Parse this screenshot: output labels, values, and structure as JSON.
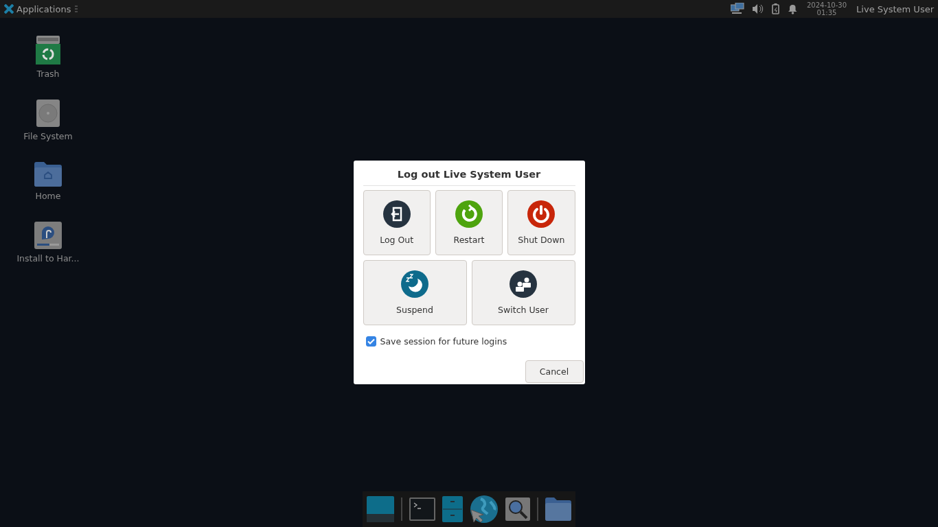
{
  "panel": {
    "menu_label": "Applications",
    "clock": {
      "date": "2024-10-30",
      "time": "01:35"
    },
    "user": "Live System User"
  },
  "desktop_icons": [
    {
      "label": "Trash",
      "kind": "trash"
    },
    {
      "label": "File System",
      "kind": "drive"
    },
    {
      "label": "Home",
      "kind": "home"
    },
    {
      "label": "Install to Har...",
      "kind": "installer"
    }
  ],
  "dialog": {
    "title": "Log out Live System User",
    "actions": [
      {
        "label": "Log Out",
        "kind": "logout"
      },
      {
        "label": "Restart",
        "kind": "restart"
      },
      {
        "label": "Shut Down",
        "kind": "shutdown"
      },
      {
        "label": "Suspend",
        "kind": "suspend"
      },
      {
        "label": "Switch User",
        "kind": "switch-user"
      }
    ],
    "save_session": {
      "label": "Save session for future logins",
      "checked": true
    },
    "cancel": "Cancel"
  },
  "dock": [
    {
      "kind": "desktop"
    },
    {
      "kind": "separator"
    },
    {
      "kind": "terminal"
    },
    {
      "kind": "cabinet"
    },
    {
      "kind": "browser"
    },
    {
      "kind": "search"
    },
    {
      "kind": "separator"
    },
    {
      "kind": "folder"
    }
  ]
}
